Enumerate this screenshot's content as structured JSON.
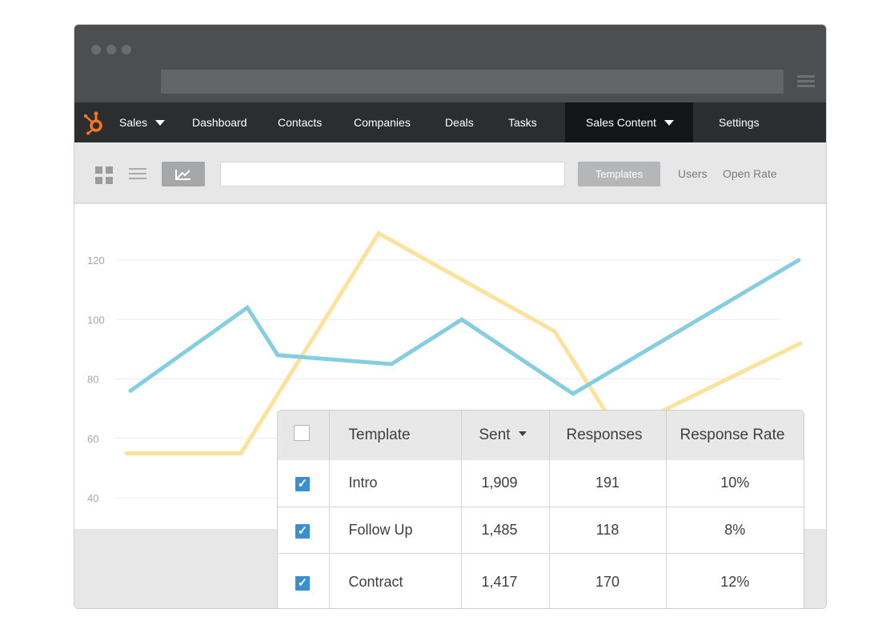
{
  "nav": {
    "items": [
      {
        "label": "Sales",
        "dropdown": true
      },
      {
        "label": "Dashboard"
      },
      {
        "label": "Contacts"
      },
      {
        "label": "Companies"
      },
      {
        "label": "Deals"
      },
      {
        "label": "Tasks"
      },
      {
        "label": "Sales Content",
        "dropdown": true,
        "active": true
      },
      {
        "label": "Settings"
      }
    ]
  },
  "toolbar": {
    "search_value": "",
    "templates_label": "Templates",
    "users_label": "Users",
    "open_rate_label": "Open Rate"
  },
  "chart_data": {
    "type": "line",
    "y_ticks": [
      "120",
      "100",
      "80",
      "60",
      "40"
    ],
    "ylim": [
      40,
      120
    ],
    "grid": true,
    "series": [
      {
        "color": "#85cde0",
        "values": [
          76,
          104,
          88,
          85,
          100,
          75,
          120
        ]
      },
      {
        "color": "#fce29b",
        "values": [
          55,
          55,
          129,
          96,
          62,
          92
        ]
      }
    ]
  },
  "table": {
    "headers": {
      "template": "Template",
      "sent": "Sent",
      "responses": "Responses",
      "rate": "Response  Rate"
    },
    "rows": [
      {
        "template": "Intro",
        "sent": "1,909",
        "responses": "191",
        "rate": "10%",
        "checked": true
      },
      {
        "template": "Follow Up",
        "sent": "1,485",
        "responses": "118",
        "rate": "8%",
        "checked": true
      },
      {
        "template": "Contract",
        "sent": "1,417",
        "responses": "170",
        "rate": "12%",
        "checked": true
      }
    ]
  },
  "colors": {
    "accent_orange": "#f57722",
    "checkbox_blue": "#3a8fd0",
    "nav_bg": "#2c2d2f"
  }
}
